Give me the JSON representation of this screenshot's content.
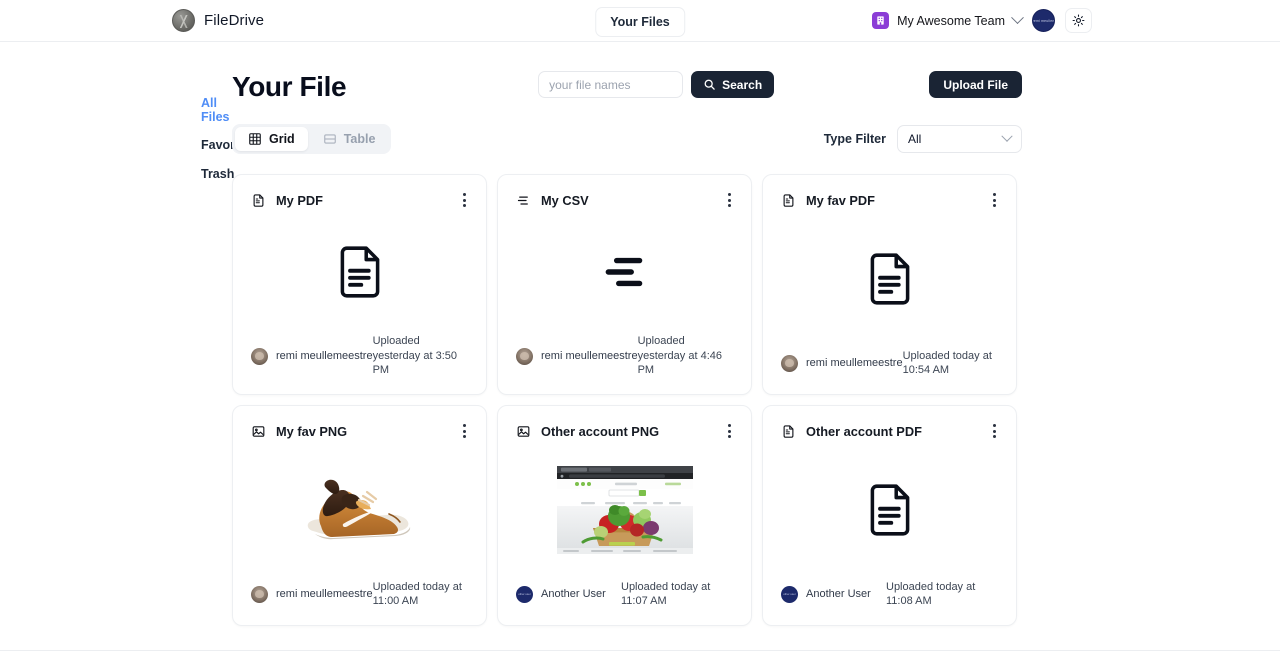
{
  "header": {
    "brand_name": "FileDrive",
    "brand_logo_icon": "filedrive-globe-logo",
    "nav_label": "Your Files",
    "team_name": "My Awesome Team",
    "team_logo_icon": "org-building-icon",
    "team_chevron_icon": "chevron-down-icon",
    "avatar_icon": "user-avatar",
    "avatar_text": "remi meullem",
    "theme_toggle_icon": "sun-icon"
  },
  "sidebar": {
    "items": [
      {
        "label": "All Files",
        "icon": "file-icon",
        "active": true
      },
      {
        "label": "Favorites",
        "icon": "star-icon",
        "active": false
      },
      {
        "label": "Trash",
        "icon": "trash-icon",
        "active": false
      }
    ]
  },
  "main": {
    "title": "Your File",
    "search": {
      "placeholder": "your file names",
      "value": ""
    },
    "search_button_label": "Search",
    "search_button_icon": "search-icon",
    "upload_button_label": "Upload File",
    "view_tabs": [
      {
        "label": "Grid",
        "icon": "grid-icon",
        "active": true
      },
      {
        "label": "Table",
        "icon": "table-icon",
        "active": false
      }
    ],
    "filter_label": "Type Filter",
    "filter_value": "All",
    "filter_chevron_icon": "chevron-down-icon",
    "menu_icon": "kebab-menu-icon"
  },
  "files": [
    {
      "title": "My PDF",
      "type_icon": "pdf-file-icon",
      "preview": "document-icon",
      "uploader": "remi meullemeestre",
      "avatar_kind": "photo",
      "avatar_text": "",
      "uploaded": "Uploaded yesterday at 3:50 PM"
    },
    {
      "title": "My CSV",
      "type_icon": "csv-file-icon",
      "preview": "csv-lines-icon",
      "uploader": "remi meullemeestre",
      "avatar_kind": "photo",
      "avatar_text": "",
      "uploaded": "Uploaded yesterday at 4:46 PM"
    },
    {
      "title": "My fav PDF",
      "type_icon": "pdf-file-icon",
      "preview": "document-icon",
      "uploader": "remi meullemeestre",
      "avatar_kind": "photo",
      "avatar_text": "",
      "uploaded": "Uploaded today at 10:54 AM"
    },
    {
      "title": "My fav PNG",
      "type_icon": "image-file-icon",
      "preview": "sneaker-photo",
      "uploader": "remi meullemeestre",
      "avatar_kind": "photo",
      "avatar_text": "",
      "uploaded": "Uploaded today at 11:00 AM"
    },
    {
      "title": "Other account PNG",
      "type_icon": "image-file-icon",
      "preview": "grocery-website-screenshot",
      "uploader": "Another User",
      "avatar_kind": "navy",
      "avatar_text": "other user",
      "uploaded": "Uploaded today at 11:07 AM"
    },
    {
      "title": "Other account PDF",
      "type_icon": "pdf-file-icon",
      "preview": "document-icon",
      "uploader": "Another User",
      "avatar_kind": "navy",
      "avatar_text": "other user",
      "uploaded": "Uploaded today at 11:08 AM"
    }
  ],
  "colors": {
    "accent": "#4f8df6",
    "dark": "#1a2434",
    "brand_purple": "#8b3dd6",
    "avatar_navy": "#1d2a6b"
  }
}
